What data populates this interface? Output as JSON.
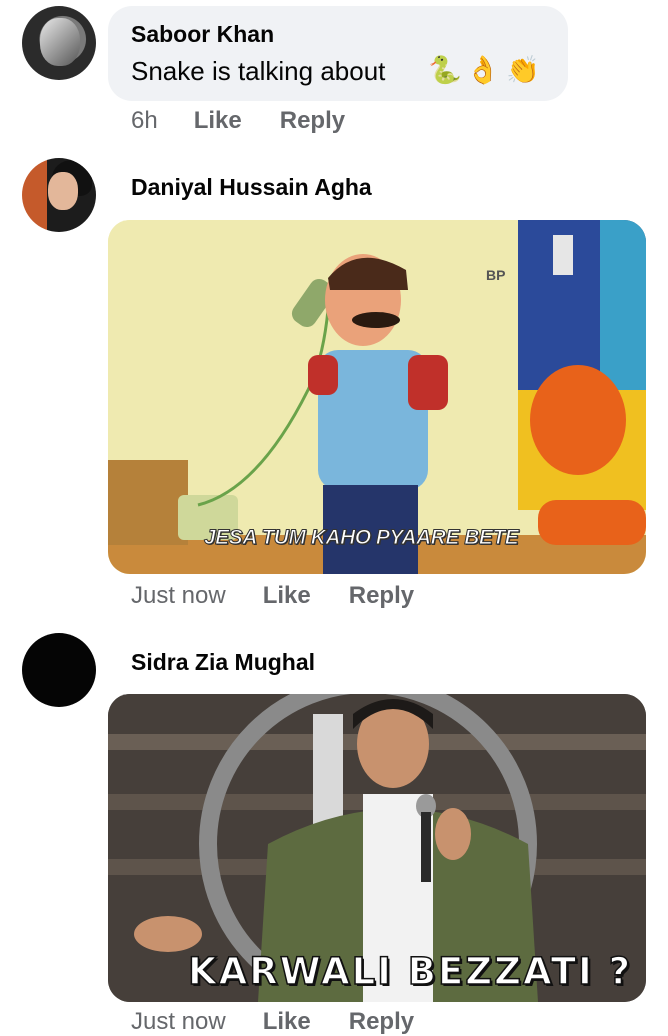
{
  "comments": [
    {
      "author": "Saboor Khan",
      "text": "Snake is talking about",
      "emojis": [
        "🐍",
        "👌",
        "👏"
      ],
      "time": "6h",
      "like": "Like",
      "reply": "Reply"
    },
    {
      "author": "Daniyal Hussain Agha",
      "media_caption": "JESA TUM KAHO PYAARE BETE",
      "media_logo": "BP",
      "time": "Just now",
      "like": "Like",
      "reply": "Reply"
    },
    {
      "author": "Sidra Zia Mughal",
      "media_caption": "KARWALI BEZZATI ?",
      "time": "Just now",
      "like": "Like",
      "reply": "Reply"
    }
  ]
}
